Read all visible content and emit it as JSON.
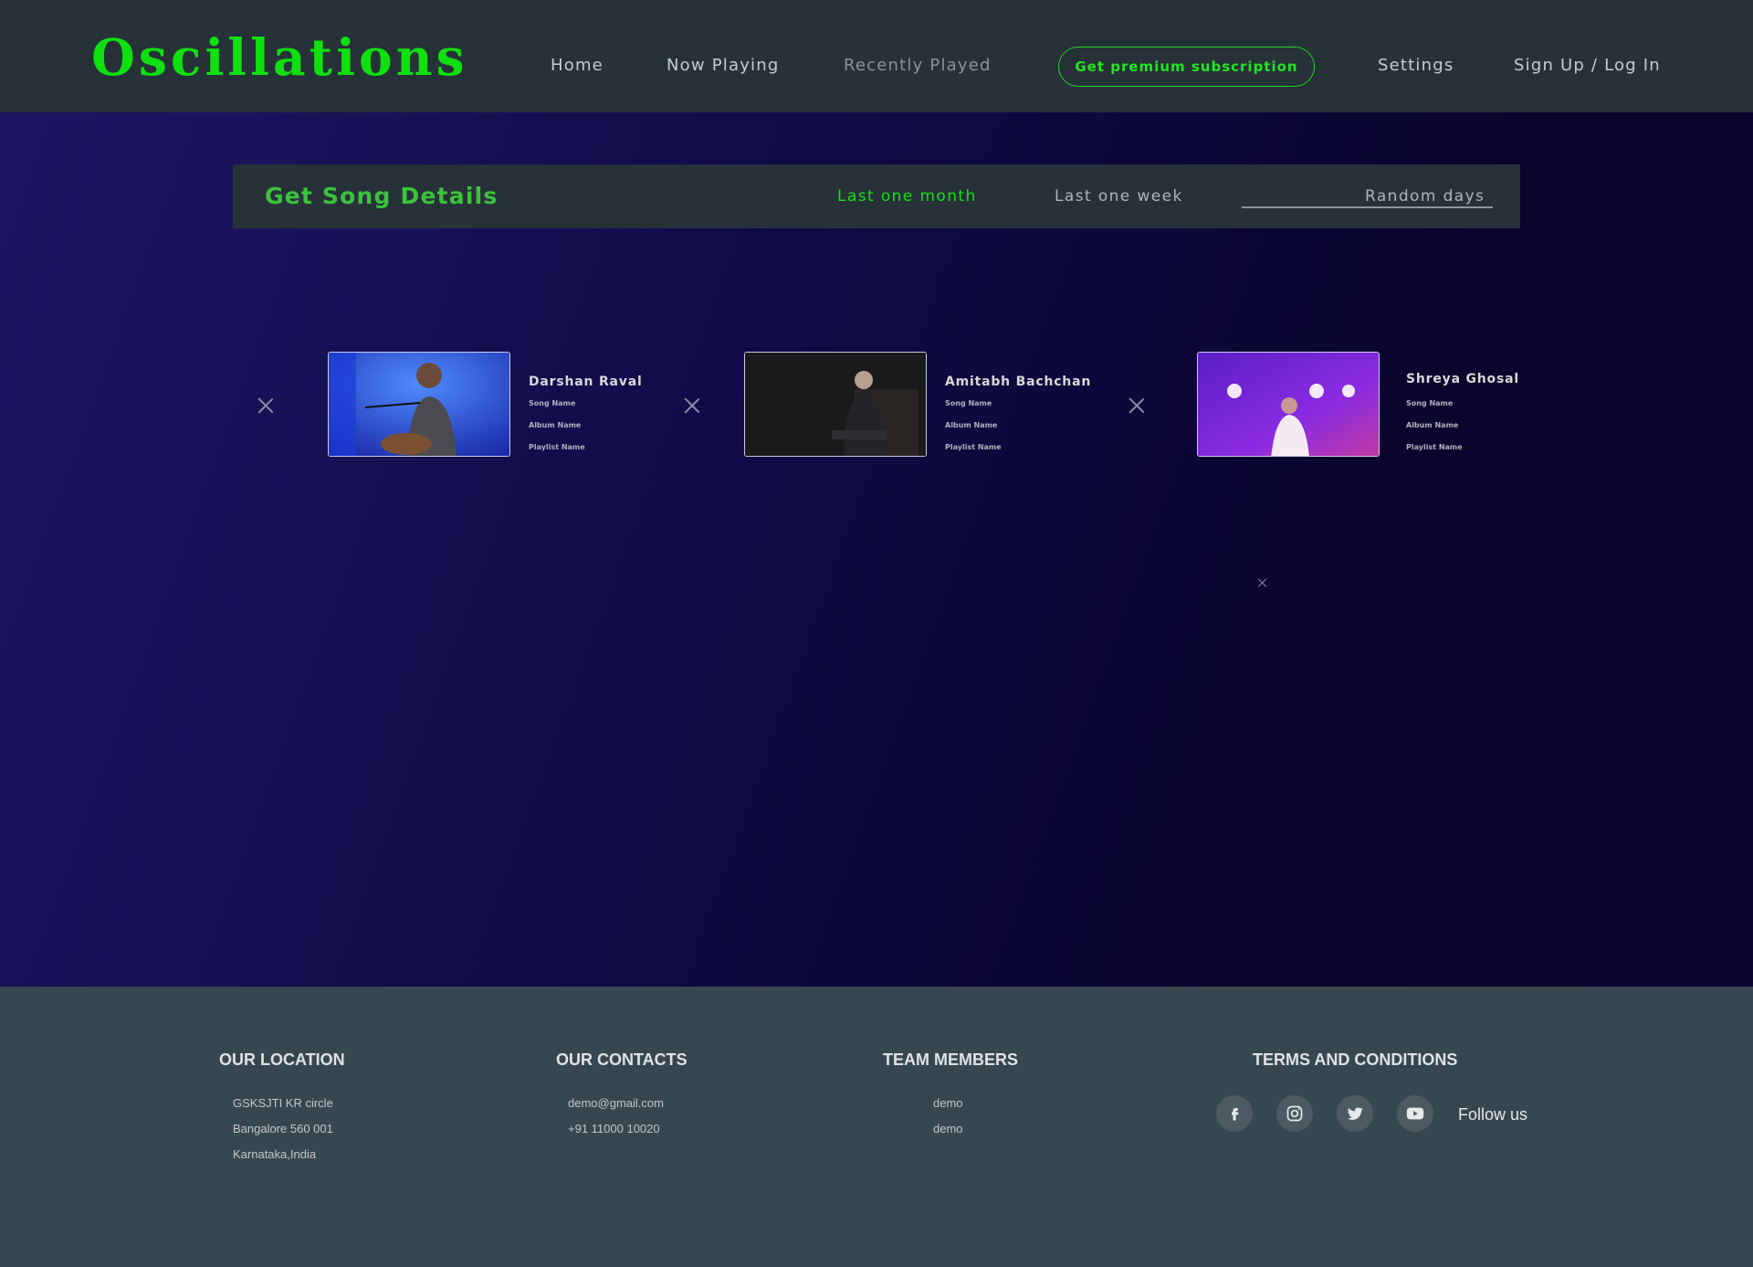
{
  "header": {
    "logo": "Oscillations",
    "nav": {
      "home": "Home",
      "now_playing": "Now Playing",
      "recently_played": "Recently Played",
      "premium": "Get premium subscription",
      "settings": "Settings",
      "auth": "Sign Up / Log In"
    }
  },
  "details": {
    "title": "Get Song Details",
    "filters": [
      "Last one month",
      "Last one week",
      "Random days"
    ],
    "active_filter": "Last one month"
  },
  "cards": [
    {
      "artist": "Darshan Raval",
      "song": "Song Name",
      "album": "Album Name",
      "playlist": "Playlist Name"
    },
    {
      "artist": "Amitabh Bachchan",
      "song": "Song Name",
      "album": "Album Name",
      "playlist": "Playlist Name"
    },
    {
      "artist": "Shreya Ghosal",
      "song": "Song Name",
      "album": "Album Name",
      "playlist": "Playlist Name"
    }
  ],
  "footer": {
    "location": {
      "heading": "OUR LOCATION",
      "lines": [
        "GSKSJTI KR circle",
        "Bangalore 560 001",
        "Karnataka,India"
      ]
    },
    "contacts": {
      "heading": "OUR CONTACTS",
      "lines": [
        "demo@gmail.com",
        "+91 11000 10020"
      ]
    },
    "team": {
      "heading": "TEAM MEMBERS",
      "lines": [
        "demo",
        "demo"
      ]
    },
    "terms": {
      "heading": "TERMS AND CONDITIONS"
    },
    "social": [
      "facebook-icon",
      "instagram-icon",
      "twitter-icon",
      "youtube-icon"
    ],
    "follow": "Follow us"
  },
  "colors": {
    "accent": "#10e010",
    "header_bg": "#263238",
    "footer_bg": "#37474f"
  }
}
